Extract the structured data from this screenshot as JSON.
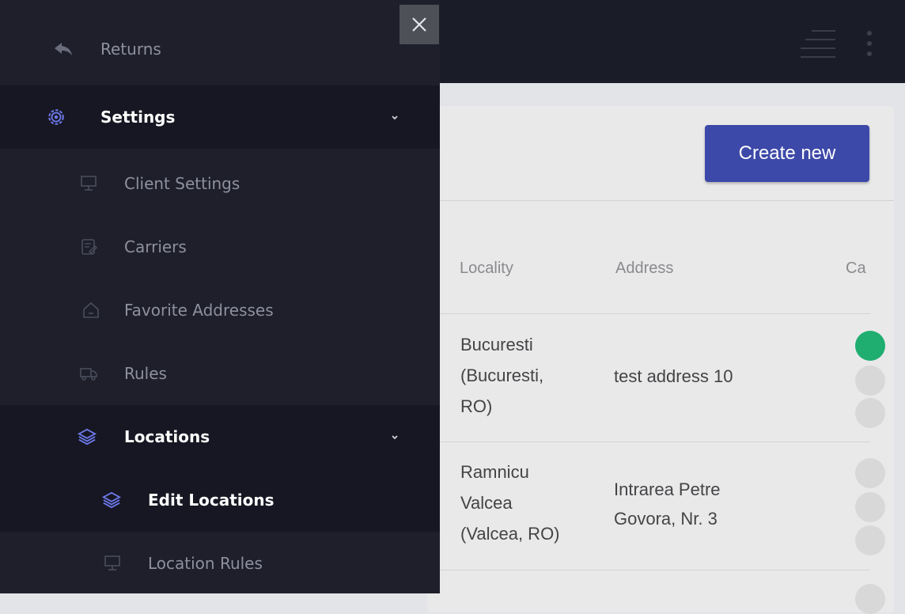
{
  "header": {
    "icons": [
      "hamburger-icon",
      "kebab-menu-icon"
    ]
  },
  "main": {
    "create_button_label": "Create new",
    "table": {
      "columns": [
        "Locality",
        "Address",
        "Ca"
      ],
      "rows": [
        {
          "locality_lines": [
            "Bucuresti",
            "(Bucuresti,",
            "RO)"
          ],
          "address_lines": [
            "test address 10"
          ],
          "toggles": [
            "on",
            "off",
            "off"
          ]
        },
        {
          "locality_lines": [
            "Ramnicu",
            "Valcea",
            "(Valcea, RO)"
          ],
          "address_lines": [
            "Intrarea Petre",
            "Govora, Nr. 3"
          ],
          "toggles": [
            "off",
            "off",
            "off"
          ]
        }
      ]
    }
  },
  "sidebar": {
    "close_icon": "close-icon",
    "items": [
      {
        "label": "Returns",
        "icon": "return-arrow-icon"
      },
      {
        "label": "Settings",
        "icon": "gear-icon",
        "expanded": true
      },
      {
        "label": "Client Settings",
        "icon": "monitor-icon"
      },
      {
        "label": "Carriers",
        "icon": "edit-document-icon"
      },
      {
        "label": "Favorite Addresses",
        "icon": "home-icon"
      },
      {
        "label": "Rules",
        "icon": "truck-icon"
      },
      {
        "label": "Locations",
        "icon": "layers-icon",
        "expanded": true
      },
      {
        "label": "Edit Locations",
        "icon": "layers-icon",
        "active": true
      },
      {
        "label": "Location Rules",
        "icon": "monitor-icon"
      }
    ]
  },
  "colors": {
    "sidebar_bg": "#1e1f2a",
    "sidebar_active_bg": "#161722",
    "accent_icon": "#6d78e8",
    "primary_button": "#3d49a8",
    "toggle_on": "#1fae6f"
  }
}
